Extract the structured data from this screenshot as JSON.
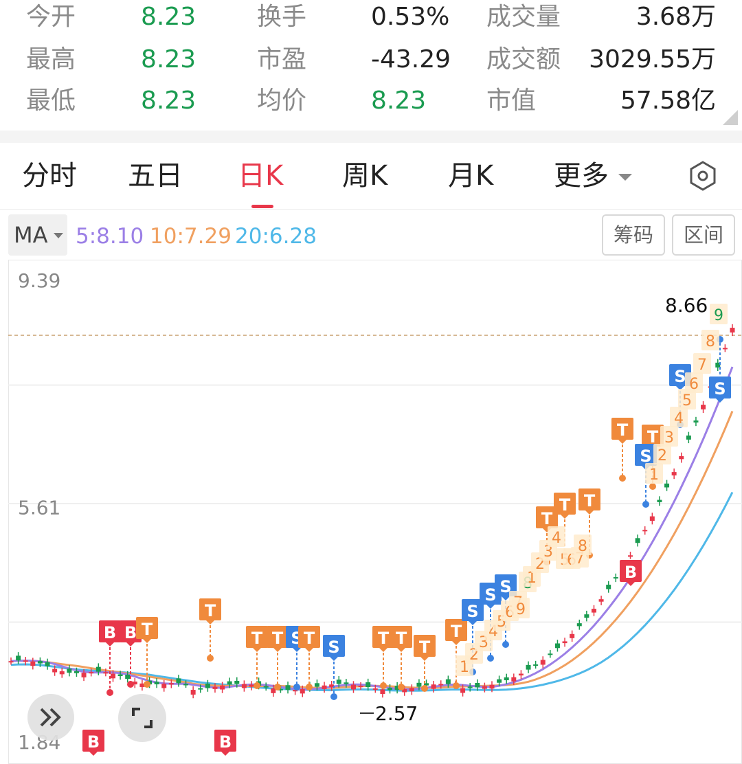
{
  "quote": {
    "rows": [
      [
        {
          "label": "今开",
          "value": "8.23",
          "color": "green"
        },
        {
          "label": "换手",
          "value": "0.53%",
          "color": "dark"
        },
        {
          "label": "成交量",
          "value": "3.68万",
          "color": "dark"
        }
      ],
      [
        {
          "label": "最高",
          "value": "8.23",
          "color": "green"
        },
        {
          "label": "市盈",
          "value": "-43.29",
          "color": "dark"
        },
        {
          "label": "成交额",
          "value": "3029.55万",
          "color": "dark"
        }
      ],
      [
        {
          "label": "最低",
          "value": "8.23",
          "color": "green"
        },
        {
          "label": "均价",
          "value": "8.23",
          "color": "green"
        },
        {
          "label": "市值",
          "value": "57.58亿",
          "color": "dark"
        }
      ]
    ]
  },
  "tabs": {
    "items": [
      "分时",
      "五日",
      "日K",
      "周K",
      "月K",
      "更多"
    ],
    "active": "日K"
  },
  "ma": {
    "selector": "MA",
    "values": [
      {
        "text": "5:8.10",
        "color": "#9b7fe6"
      },
      {
        "text": "10:7.29",
        "color": "#f0a060"
      },
      {
        "text": "20:6.28",
        "color": "#4fb8e8"
      }
    ],
    "chip_label": "筹码",
    "interval_label": "区间"
  },
  "chart_data": {
    "type": "candlestick",
    "y_axis_labels": [
      "9.39",
      "5.61",
      "1.84"
    ],
    "ylim": [
      1.84,
      9.39
    ],
    "price_labels": {
      "high": "8.66",
      "low": "2.57"
    },
    "reference_line": 8.23,
    "ma_legend": {
      "MA5": 8.1,
      "MA10": 7.29,
      "MA20": 6.28
    },
    "signal_tags": [
      "B",
      "T",
      "S",
      "1",
      "2",
      "3",
      "4",
      "5",
      "6",
      "7",
      "8",
      "9"
    ],
    "colors": {
      "up": "#e8374a",
      "down": "#1a9b50",
      "ma5": "#9b7fe6",
      "ma10": "#f0a060",
      "ma20": "#4fb8e8",
      "buy": "#e8374a",
      "sell": "#3b82e0",
      "t": "#f08a3c"
    }
  },
  "controls": {
    "expand_glyph": "»",
    "fullscreen_glyph": "⛶"
  }
}
